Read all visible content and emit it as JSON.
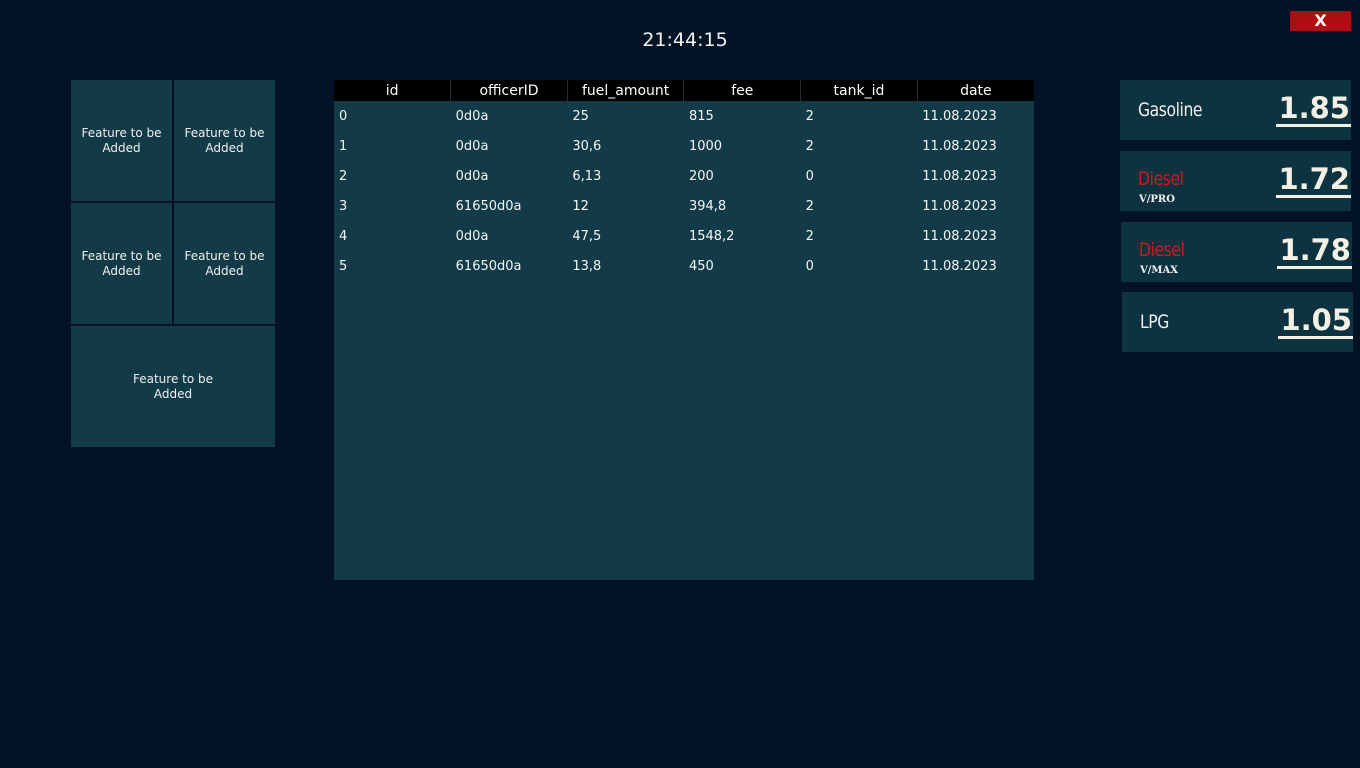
{
  "header": {
    "clock": "21:44:15",
    "close_label": "X"
  },
  "feature_tiles": [
    {
      "label": "Feature to be Added"
    },
    {
      "label": "Feature to be Added"
    },
    {
      "label": "Feature to be Added"
    },
    {
      "label": "Feature to be Added"
    },
    {
      "label": "Feature to be Added"
    }
  ],
  "fuel_log": {
    "columns": [
      "id",
      "officerID",
      "fuel_amount",
      "fee",
      "tank_id",
      "date"
    ],
    "rows": [
      [
        "0",
        "0d0a",
        "25",
        "815",
        "2",
        "11.08.2023"
      ],
      [
        "1",
        "0d0a",
        "30,6",
        "1000",
        "2",
        "11.08.2023"
      ],
      [
        "2",
        "0d0a",
        "6,13",
        "200",
        "0",
        "11.08.2023"
      ],
      [
        "3",
        "61650d0a",
        "12",
        "394,8",
        "2",
        "11.08.2023"
      ],
      [
        "4",
        "0d0a",
        "47,5",
        "1548,2",
        "2",
        "11.08.2023"
      ],
      [
        "5",
        "61650d0a",
        "13,8",
        "450",
        "0",
        "11.08.2023"
      ]
    ]
  },
  "prices": [
    {
      "name": "Gasoline",
      "sub": "",
      "price": "1.85",
      "name_color": "#f0f0f0"
    },
    {
      "name": "Diesel",
      "sub": "V/PRO",
      "price": "1.72",
      "name_color": "#d4171b"
    },
    {
      "name": "Diesel",
      "sub": "V/MAX",
      "price": "1.78",
      "name_color": "#d4171b"
    },
    {
      "name": "LPG",
      "sub": "",
      "price": "1.05",
      "name_color": "#f0f0f0"
    }
  ],
  "colors": {
    "background": "#011324",
    "panel": "#123b47",
    "price_card": "#0d3340",
    "close_button": "#b00d12",
    "table_header": "#000000"
  }
}
